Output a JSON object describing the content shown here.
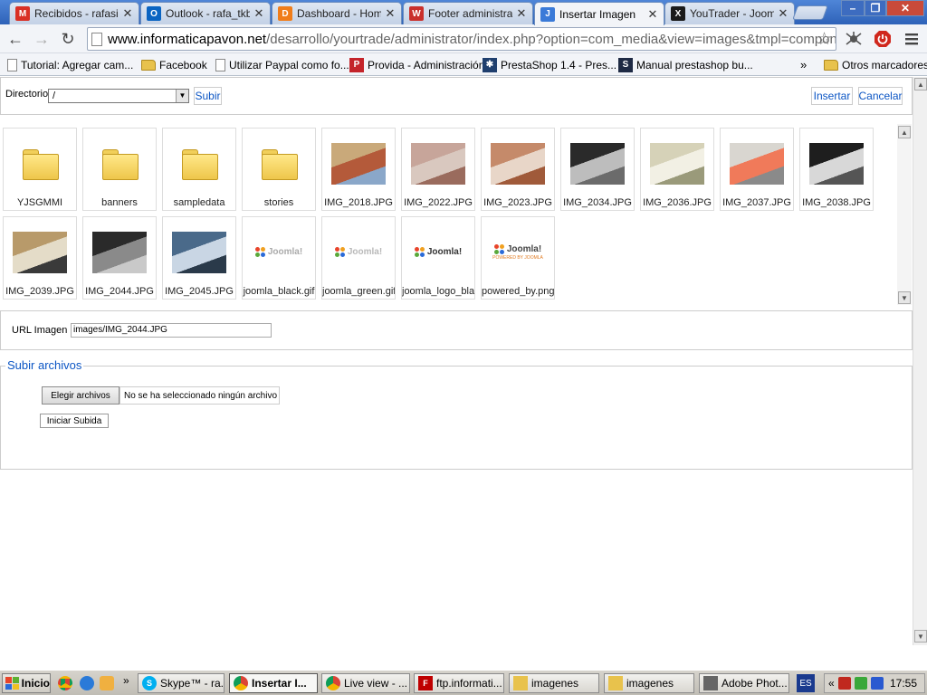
{
  "browser": {
    "tabs": [
      {
        "title": "Recibidos - rafasim",
        "favicon": "gmail-icon",
        "color": "#d93025",
        "glyph": "M"
      },
      {
        "title": "Outlook - rafa_tkb",
        "favicon": "outlook-icon",
        "color": "#0a64c2",
        "glyph": "O"
      },
      {
        "title": "Dashboard - Home",
        "favicon": "dashboard-icon",
        "color": "#f07d1a",
        "glyph": "D"
      },
      {
        "title": "Footer administrac",
        "favicon": "w-logo-icon",
        "color": "#c9302c",
        "glyph": "W"
      },
      {
        "title": "Insertar Imagen",
        "favicon": "joomla-icon",
        "color": "#3a7ad8",
        "glyph": "J",
        "active": true
      },
      {
        "title": "YouTrader - Joomla",
        "favicon": "joomla-icon",
        "color": "#1a1a1a",
        "glyph": "X"
      }
    ],
    "url_host": "www.informaticapavon.net",
    "url_path": "/desarrollo/yourtrade/administrator/index.php?option=com_media&view=images&tmpl=component&e_name=",
    "bookmarks": [
      {
        "label": "Tutorial: Agregar cam...",
        "icon": "doc-icon"
      },
      {
        "label": "Facebook",
        "icon": "folder-icon"
      },
      {
        "label": "Utilizar Paypal como fo...",
        "icon": "doc-icon"
      },
      {
        "label": "Provida - Administración",
        "icon": "provida-icon"
      },
      {
        "label": "PrestaShop 1.4 - Pres...",
        "icon": "prestashop-icon"
      },
      {
        "label": "Manual prestashop bu...",
        "icon": "s-logo-icon"
      }
    ],
    "bookmarks_overflow": "»",
    "other_bookmarks": "Otros marcadores"
  },
  "media_manager": {
    "directory_label": "Directorio",
    "directory_value": "/",
    "up_button": "Subir",
    "insert_button": "Insertar",
    "cancel_button": "Cancelar",
    "items": [
      {
        "name": "YJSGMMI",
        "kind": "folder"
      },
      {
        "name": "banners",
        "kind": "folder"
      },
      {
        "name": "sampledata",
        "kind": "folder"
      },
      {
        "name": "stories",
        "kind": "folder"
      },
      {
        "name": "IMG_2018.JPG",
        "kind": "photo",
        "palette": [
          "#c9a97a",
          "#b45a3a",
          "#8aa7c9"
        ]
      },
      {
        "name": "IMG_2022.JPG",
        "kind": "photo",
        "palette": [
          "#c7a59a",
          "#d9c8bf",
          "#9a6b5d"
        ]
      },
      {
        "name": "IMG_2023.JPG",
        "kind": "photo",
        "palette": [
          "#c58a6a",
          "#e8d6c8",
          "#a05a3a"
        ]
      },
      {
        "name": "IMG_2034.JPG",
        "kind": "photo",
        "palette": [
          "#2a2a2a",
          "#bdbdbd",
          "#6b6b6b"
        ]
      },
      {
        "name": "IMG_2036.JPG",
        "kind": "photo",
        "palette": [
          "#d6d2b8",
          "#f2f0e4",
          "#9a9a7a"
        ]
      },
      {
        "name": "IMG_2037.JPG",
        "kind": "photo",
        "palette": [
          "#d9d6d0",
          "#f07a5a",
          "#8a8a8a"
        ]
      },
      {
        "name": "IMG_2038.JPG",
        "kind": "photo",
        "palette": [
          "#1e1e1e",
          "#d8d8d8",
          "#555555"
        ]
      },
      {
        "name": "IMG_2039.JPG",
        "kind": "photo",
        "palette": [
          "#b89a6a",
          "#e4dcc8",
          "#3a3a3a"
        ]
      },
      {
        "name": "IMG_2044.JPG",
        "kind": "photo",
        "palette": [
          "#2a2a2a",
          "#8a8a8a",
          "#c9c9c9"
        ]
      },
      {
        "name": "IMG_2045.JPG",
        "kind": "photo",
        "palette": [
          "#4a6a8a",
          "#c9d6e4",
          "#2a3a4a"
        ]
      },
      {
        "name": "joomla_black.gif",
        "kind": "logo",
        "logo_text": "Joomla!",
        "logo_color": "#aaaaaa"
      },
      {
        "name": "joomla_green.gif",
        "kind": "logo",
        "logo_text": "Joomla!",
        "logo_color": "#b9b9b9"
      },
      {
        "name": "joomla_logo_black.jpg",
        "kind": "logo",
        "logo_text": "Joomla!",
        "logo_color": "#333333"
      },
      {
        "name": "powered_by.png",
        "kind": "logo",
        "logo_text": "Joomla!",
        "logo_color": "#444444",
        "sub_text": "POWERED BY JOOMLA"
      }
    ],
    "url_label": "URL Imagen",
    "url_value": "images/IMG_2044.JPG",
    "upload_legend": "Subir archivos",
    "choose_button": "Elegir archivos",
    "no_file_text": "No se ha seleccionado ningún archivo",
    "start_upload_button": "Iniciar Subida"
  },
  "taskbar": {
    "start_label": "Inicio",
    "items": [
      {
        "label": "Skype™ - ra...",
        "icon": "skype-icon",
        "color": "#00aff0",
        "glyph": "S"
      },
      {
        "label": "Insertar I...",
        "icon": "chrome-icon",
        "color": "#db4437",
        "glyph": "",
        "active": true
      },
      {
        "label": "Live view - ...",
        "icon": "chrome-icon",
        "color": "#db4437",
        "glyph": ""
      },
      {
        "label": "ftp.informati...",
        "icon": "filezilla-icon",
        "color": "#bf0000",
        "glyph": "F"
      },
      {
        "label": "imagenes",
        "icon": "folder-icon",
        "color": "#e8c24c",
        "glyph": ""
      },
      {
        "label": "imagenes",
        "icon": "folder-icon",
        "color": "#e8c24c",
        "glyph": ""
      },
      {
        "label": "Adobe Phot...",
        "icon": "photoshop-icon",
        "color": "#666666",
        "glyph": ""
      }
    ],
    "quicklaunch_overflow": "»",
    "language": "ES",
    "tray_overflow": "«",
    "clock": "17:55"
  }
}
